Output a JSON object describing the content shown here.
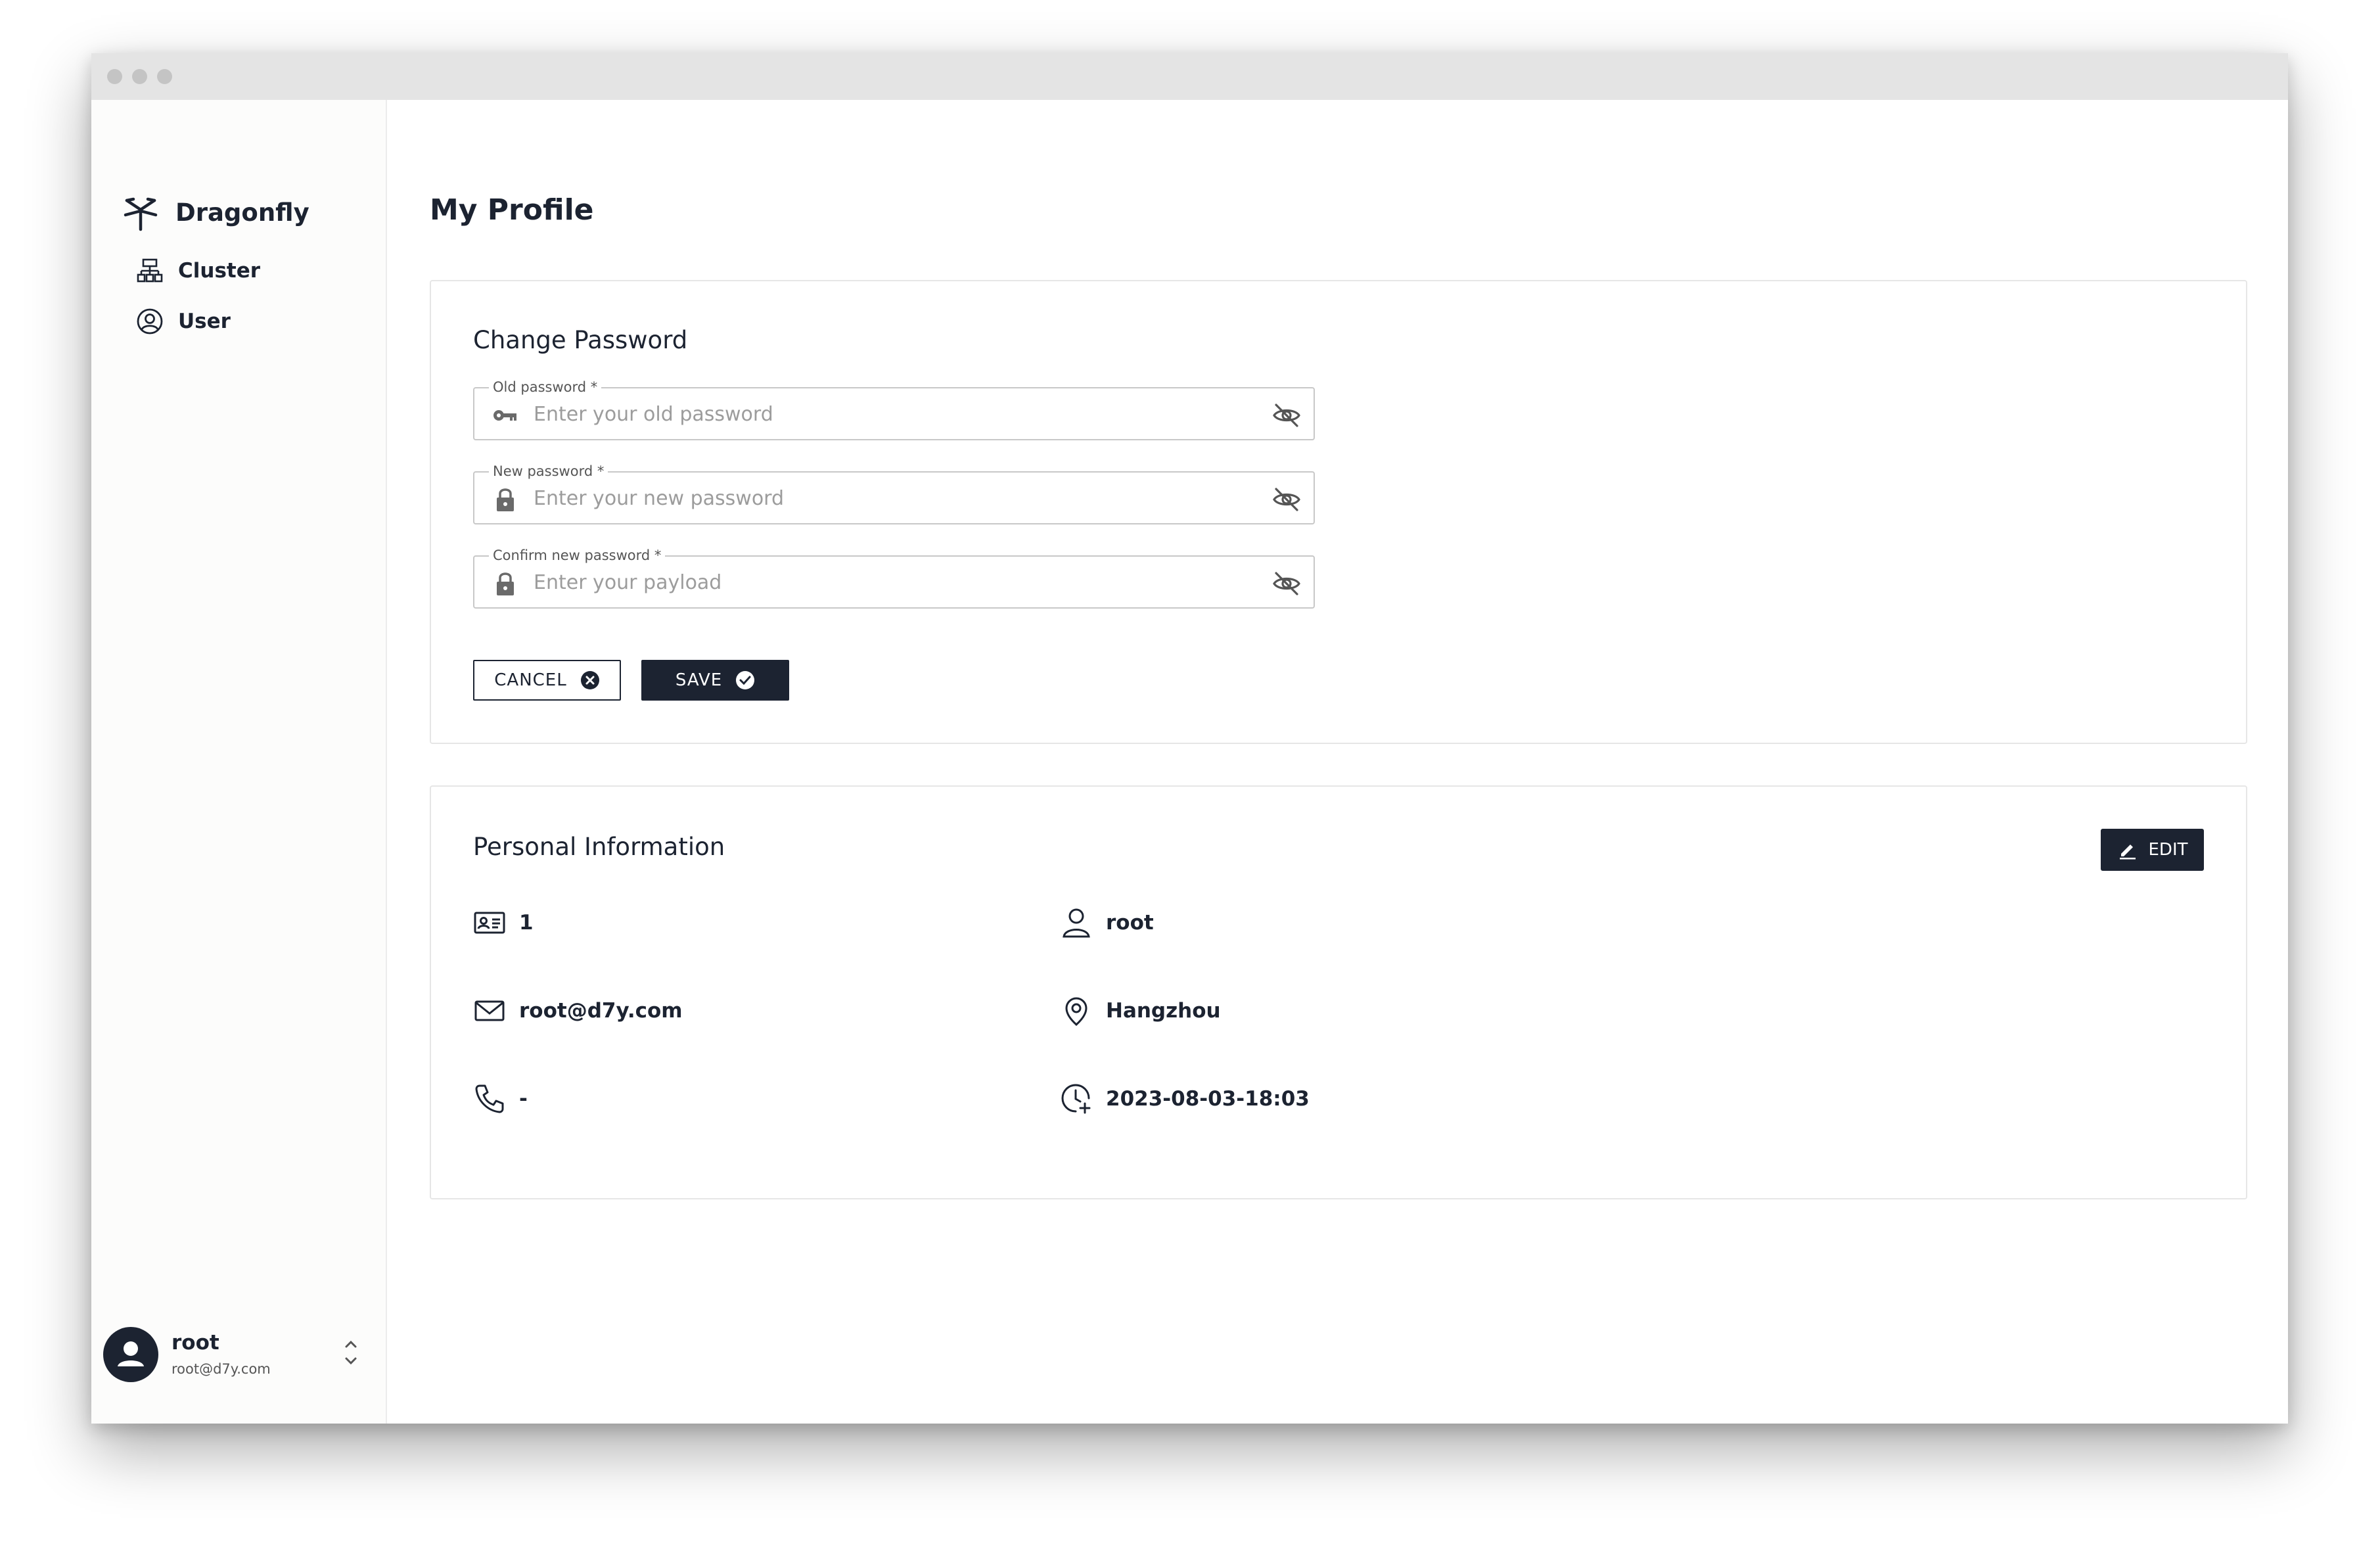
{
  "app": {
    "name": "Dragonfly"
  },
  "sidebar": {
    "items": [
      {
        "label": "Cluster",
        "icon": "cluster-icon"
      },
      {
        "label": "User",
        "icon": "user-circle-icon"
      }
    ],
    "user": {
      "name": "root",
      "email": "root@d7y.com"
    }
  },
  "page": {
    "title": "My Profile"
  },
  "change_password": {
    "title": "Change Password",
    "fields": [
      {
        "label": "Old password *",
        "placeholder": "Enter your old password",
        "value": "",
        "icon": "key-icon"
      },
      {
        "label": "New password *",
        "placeholder": "Enter your new password",
        "value": "",
        "icon": "lock-icon"
      },
      {
        "label": "Confirm new password *",
        "placeholder": "Enter your payload",
        "value": "",
        "icon": "lock-icon"
      }
    ],
    "cancel_label": "CANCEL",
    "save_label": "SAVE"
  },
  "personal_info": {
    "title": "Personal Information",
    "edit_label": "EDIT",
    "id": "1",
    "name": "root",
    "email": "root@d7y.com",
    "location": "Hangzhou",
    "phone": "-",
    "created_at": "2023-08-03-18:03"
  },
  "colors": {
    "primary": "#1c2331",
    "sidebar_bg": "#fcfcfb",
    "border": "#e6e6e6"
  }
}
